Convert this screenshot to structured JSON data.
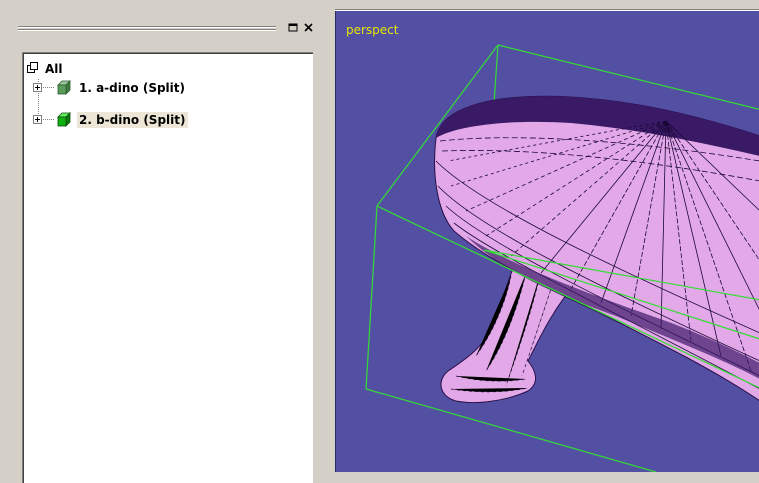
{
  "outliner": {
    "root": {
      "label": "All",
      "icon": "layers-icon"
    },
    "items": [
      {
        "label": "1. a-dino (Split)",
        "icon": "mesh-cube-icon",
        "selected": false,
        "icon_color": "#5a9a5a"
      },
      {
        "label": "2. b-dino (Split)",
        "icon": "mesh-cube-icon",
        "selected": true,
        "icon_color": "#10b010"
      }
    ]
  },
  "viewport": {
    "label": "perspect",
    "background_color": "#5350a4",
    "mesh_color": "#e3a8e8",
    "bbox_color": "#33dd33"
  }
}
